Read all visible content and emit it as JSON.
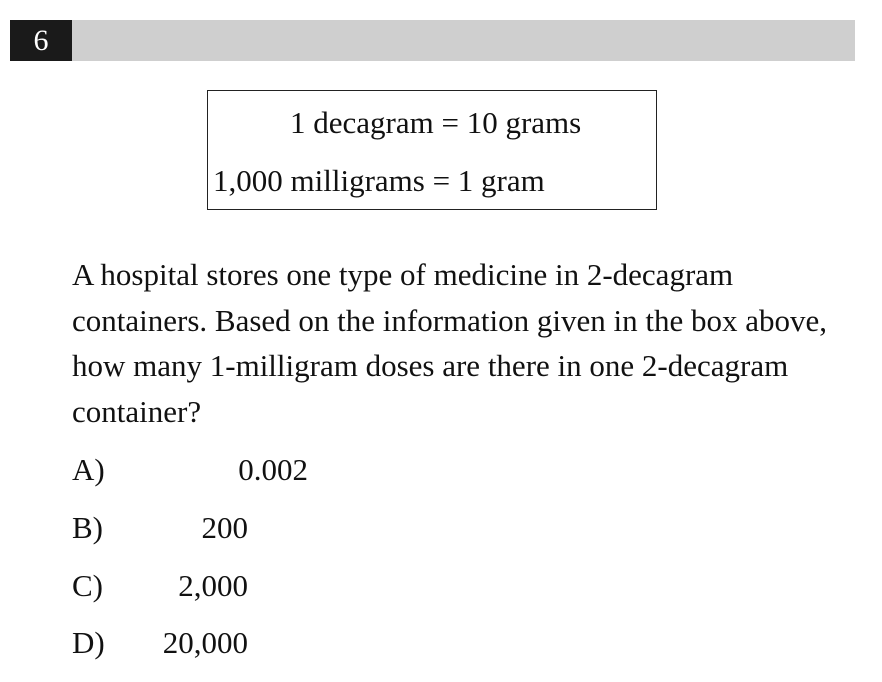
{
  "question_number": "6",
  "box": {
    "line1": "1 decagram = 10 grams",
    "line2": "1,000 milligrams = 1 gram"
  },
  "question": "A hospital stores one type of medicine in 2-decagram containers.  Based on the information given in the box above, how many 1-milligram doses are there in one 2-decagram container?",
  "choices": [
    {
      "letter": "A)",
      "value": "0.002"
    },
    {
      "letter": "B)",
      "value": "200"
    },
    {
      "letter": "C)",
      "value": "2,000"
    },
    {
      "letter": "D)",
      "value": "20,000"
    }
  ]
}
